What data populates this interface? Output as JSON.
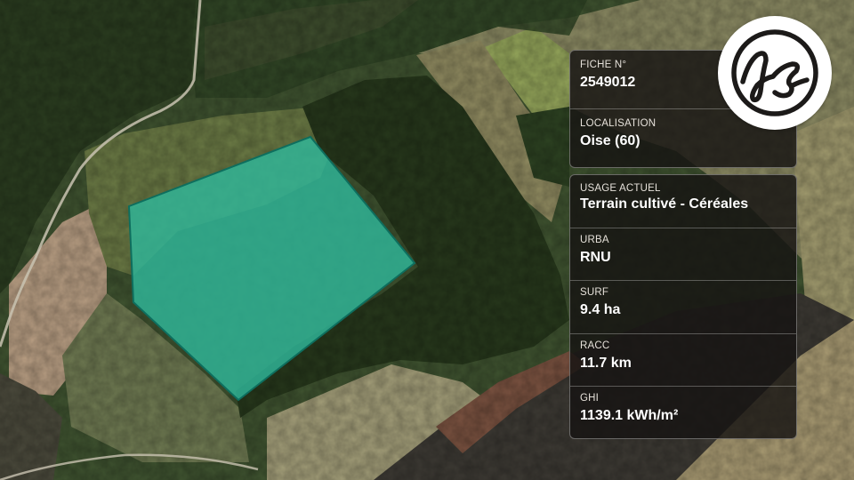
{
  "map": {
    "parcel_color": "#2fb79a",
    "parcel_outline_color": "#0e6e5e"
  },
  "logo": {
    "text": "fs",
    "icon": "fs-monogram-logo"
  },
  "fiche": {
    "number_label": "FICHE N°",
    "number_value": "2549012",
    "location_label": "LOCALISATION",
    "location_value": "Oise (60)"
  },
  "details": [
    {
      "label": "USAGE ACTUEL",
      "value": "Terrain cultivé - Céréales"
    },
    {
      "label": "URBA",
      "value": "RNU"
    },
    {
      "label": "SURF",
      "value": "9.4 ha"
    },
    {
      "label": "RACC",
      "value": "11.7 km"
    },
    {
      "label": "GHI",
      "value": "1139.1 kWh/m²"
    }
  ]
}
